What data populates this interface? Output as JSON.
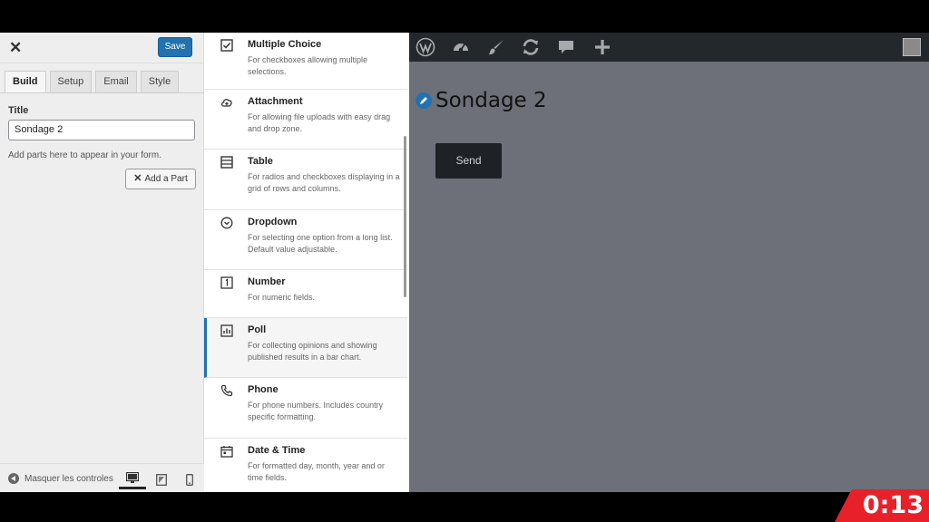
{
  "left_panel": {
    "save_label": "Save",
    "tabs": [
      {
        "label": "Build",
        "active": true
      },
      {
        "label": "Setup",
        "active": false
      },
      {
        "label": "Email",
        "active": false
      },
      {
        "label": "Style",
        "active": false
      }
    ],
    "title_label": "Title",
    "title_value": "Sondage 2",
    "hint": "Add parts here to appear in your form.",
    "add_part_label": "Add a Part",
    "collapse_label": "Masquer les controles"
  },
  "parts": [
    {
      "name": "Multiple Choice",
      "desc": "For checkboxes allowing multiple selections.",
      "icon": "checkbox-icon"
    },
    {
      "name": "Attachment",
      "desc": "For allowing file uploads with easy drag and drop zone.",
      "icon": "upload-cloud-icon"
    },
    {
      "name": "Table",
      "desc": "For radios and checkboxes displaying in a grid of rows and columns.",
      "icon": "table-icon"
    },
    {
      "name": "Dropdown",
      "desc": "For selecting one option from a long list. Default value adjustable.",
      "icon": "dropdown-icon"
    },
    {
      "name": "Number",
      "desc": "For numeric fields.",
      "icon": "number-icon"
    },
    {
      "name": "Poll",
      "desc": "For collecting opinions and showing published results in a bar chart.",
      "icon": "poll-icon"
    },
    {
      "name": "Phone",
      "desc": "For phone numbers. Includes country specific formatting.",
      "icon": "phone-icon"
    },
    {
      "name": "Date & Time",
      "desc": "For formatted day, month, year and or time fields.",
      "icon": "calendar-icon"
    }
  ],
  "preview": {
    "page_title": "Sondage 2",
    "send_label": "Send"
  },
  "timer": "0:13",
  "colors": {
    "accent": "#2271b1",
    "preview_bg": "#6d7079",
    "adminbar": "#23282d",
    "timer_bg": "#e8202a"
  }
}
